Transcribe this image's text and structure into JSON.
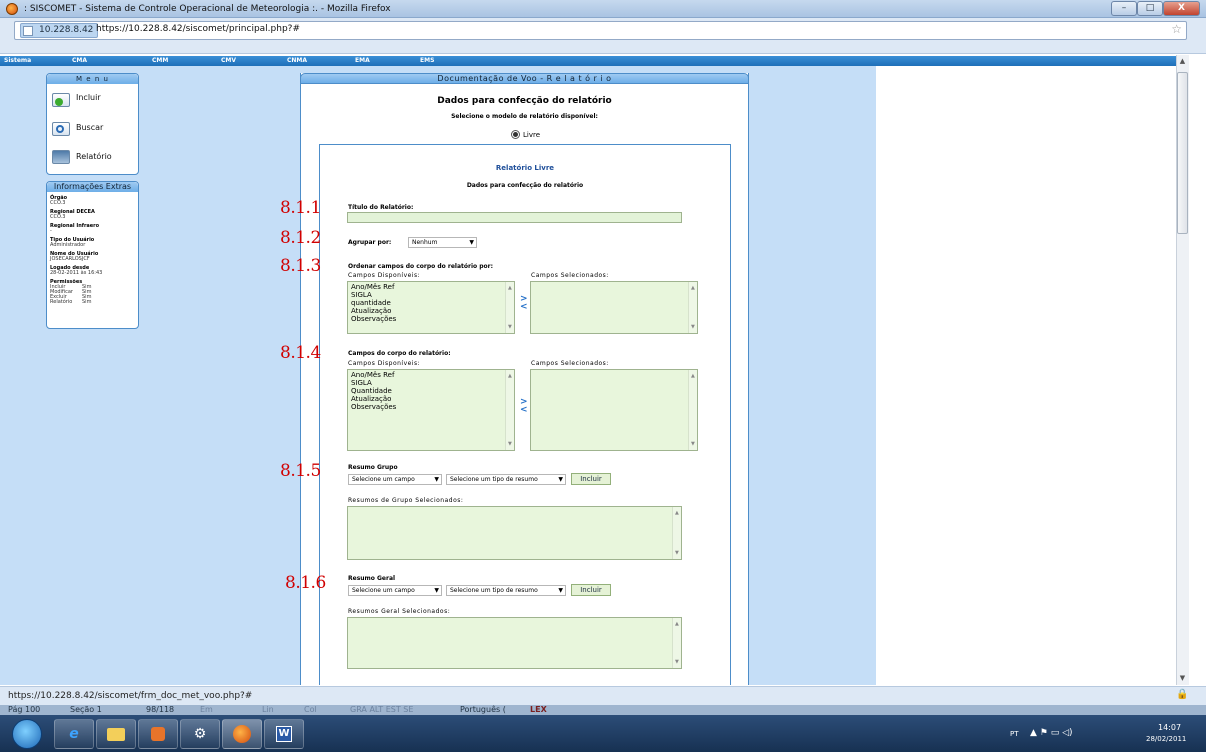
{
  "window": {
    "title": ": SISCOMET - Sistema de Controle Operacional de Meteorologia :. - Mozilla Firefox",
    "minimize": "–",
    "maximize": "□",
    "close": "X"
  },
  "address": {
    "site": "10.228.8.42",
    "url": "https://10.228.8.42/siscomet/principal.php?#"
  },
  "topmenu": [
    "Sistema",
    "CMA",
    "CMM",
    "CMV",
    "CNMA",
    "EMA",
    "EMS"
  ],
  "sidebar": {
    "title": "M e n u",
    "items": [
      "Incluir",
      "Buscar",
      "Relatório"
    ],
    "extras_title": "Informações Extras",
    "orgao_label": "Órgão",
    "orgao": "CCO.3",
    "regional_decea_label": "Regional DECEA",
    "regional_decea": "CCO.3",
    "regional_infraero_label": "Regional Infraero",
    "regional_infraero": "-",
    "tipo_label": "Tipo do Usuário",
    "tipo": "Administrador",
    "nome_label": "Nome do Usuário",
    "nome": "JOSECARLOSJCF",
    "logado_label": "Logado desde",
    "logado": "28-02-2011 às 16:43",
    "perm_label": "Permissões",
    "perms": [
      {
        "name": "Incluir",
        "value": "Sim"
      },
      {
        "name": "Modificar",
        "value": "Sim"
      },
      {
        "name": "Excluir",
        "value": "Sim"
      },
      {
        "name": "Relatório",
        "value": "Sim"
      }
    ]
  },
  "main": {
    "header": "Documentação de Voo - R e l a t ó r i o",
    "heading": "Dados para confecção do relatório",
    "select_model": "Selecione o modelo de relatório disponível:",
    "radio_label": "Livre",
    "inner_title": "Relatório Livre",
    "inner_sub": "Dados para confecção do relatório",
    "titulo_label": "Título do Relatório:",
    "agrupar_label": "Agrupar por:",
    "agrupar_value": "Nenhum",
    "ordenar_label": "Ordenar campos do corpo do relatório por:",
    "campos_label": "Campos do corpo do relatório:",
    "disponiveis": "Campos Disponíveis:",
    "selecionados": "Campos Selecionados:",
    "list1": [
      "Ano/Mês Ref",
      "SIGLA",
      "quantidade",
      "Atualização",
      "Observações"
    ],
    "list2": [
      "Ano/Mês Ref",
      "SIGLA",
      "Quantidade",
      "Atualização",
      "Observações"
    ],
    "resumo_grupo_label": "Resumo Grupo",
    "resumo_geral_label": "Resumo Geral",
    "sel_campo": "Selecione um campo",
    "sel_tipo": "Selecione um tipo de resumo",
    "incluir": "Incluir",
    "grupo_sel_label": "Resumos de Grupo Selecionados:",
    "geral_sel_label": "Resumos Geral Selecionados:",
    "arrows": "> <"
  },
  "annotations": [
    "8.1.1",
    "8.1.2",
    "8.1.3",
    "8.1.4",
    "8.1.5",
    "8.1.6"
  ],
  "status": {
    "url": "https://10.228.8.42/siscomet/frm_doc_met_voo.php?#"
  },
  "wordbar": {
    "page": "Pág 100",
    "section": "Seção 1",
    "count": "98/118",
    "em": "Em",
    "lin": "Lin",
    "col": "Col",
    "modes": "GRA ALT EST SE",
    "lang": "Português (",
    "sym": "LEX"
  },
  "tray": {
    "lang": "PT",
    "time": "14:07",
    "date": "28/02/2011"
  }
}
